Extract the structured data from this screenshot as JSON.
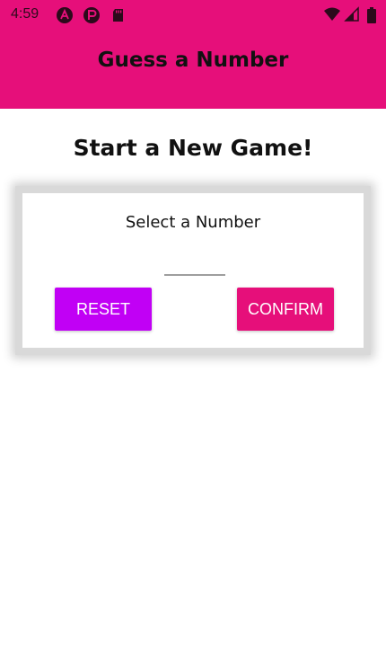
{
  "status_bar": {
    "time": "4:59",
    "left_icons": [
      "android-studio-icon",
      "pocket-icon",
      "sd-card-icon"
    ],
    "right_icons": [
      "wifi-icon",
      "signal-icon",
      "battery-icon"
    ]
  },
  "header": {
    "title": "Guess a Number"
  },
  "screen": {
    "title": "Start a New Game!"
  },
  "card": {
    "label": "Select a Number",
    "input_value": "",
    "reset_label": "RESET",
    "confirm_label": "CONFIRM"
  },
  "colors": {
    "primary": "#e60f7a",
    "accent": "#c100f5"
  }
}
